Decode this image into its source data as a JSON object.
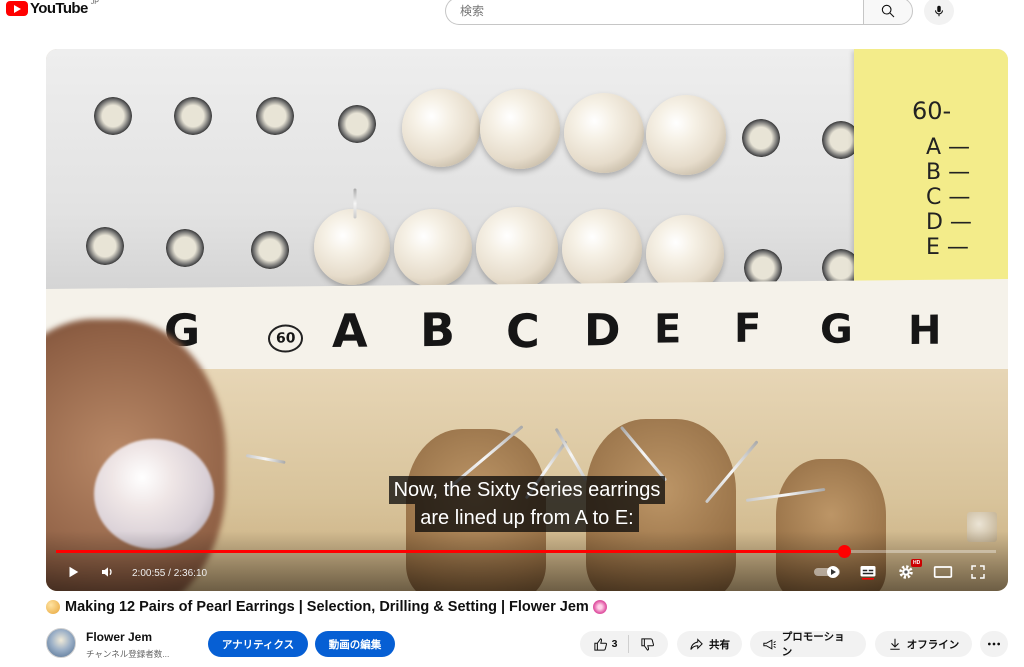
{
  "header": {
    "logo_text": "YouTube",
    "logo_region": "JP",
    "search_placeholder": "検索",
    "icons": [
      "youtube-logo-icon",
      "search-icon",
      "mic-icon"
    ]
  },
  "player": {
    "caption_lines": [
      "Now, the Sixty Series earrings",
      "are lined up from A to E:"
    ],
    "time_current": "2:00:55",
    "time_separator": " / ",
    "time_total": "2:36:10",
    "progress_fraction": 0.8382,
    "sticky_note_text": [
      "60-",
      "A —",
      "B —",
      "C —",
      "D —",
      "E —"
    ],
    "tape_letters": [
      "G",
      "60",
      "A",
      "B",
      "C",
      "D",
      "E",
      "F",
      "G",
      "H"
    ],
    "hd_badge": "HD",
    "accent_color": "#ff0000",
    "icons": [
      "play-icon",
      "volume-icon",
      "autoplay-toggle-icon",
      "subtitles-icon",
      "settings-icon",
      "theater-mode-icon",
      "fullscreen-icon"
    ]
  },
  "video": {
    "title": "Making 12 Pairs of Pearl Earrings | Selection, Drilling & Setting | Flower Jem",
    "channel_name": "Flower Jem",
    "subscribers": "チャンネル登録者数...",
    "analytics_label": "アナリティクス",
    "edit_label": "動画の編集",
    "like_count": "3",
    "share_label": "共有",
    "promotion_label": "プロモーション",
    "offline_label": "オフライン",
    "brand_blue": "#065fd4"
  }
}
